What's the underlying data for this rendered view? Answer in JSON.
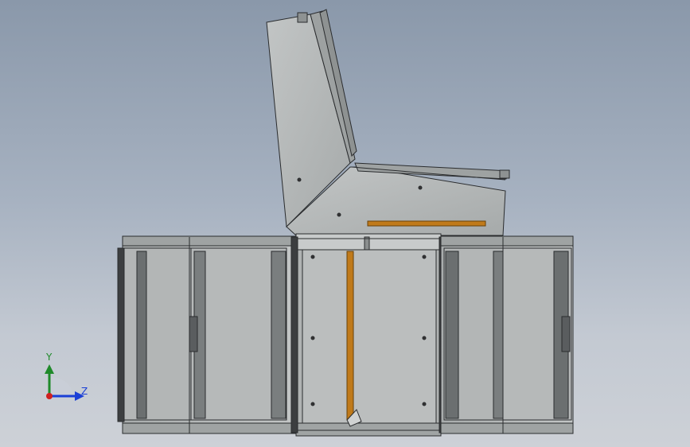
{
  "view": {
    "background_top": "#8a98aa",
    "background_bottom": "#cdd1d7"
  },
  "model": {
    "body_color": "#b9bcbc",
    "panel_color": "#adb1b1",
    "edge_color": "#2a2c2e",
    "accent_bar_color": "#c07a1a"
  },
  "triad": {
    "y_label": "Y",
    "z_label": "Z",
    "y_color": "#1f8a2a",
    "z_color": "#1a3fd6",
    "x_color": "#d02020"
  }
}
